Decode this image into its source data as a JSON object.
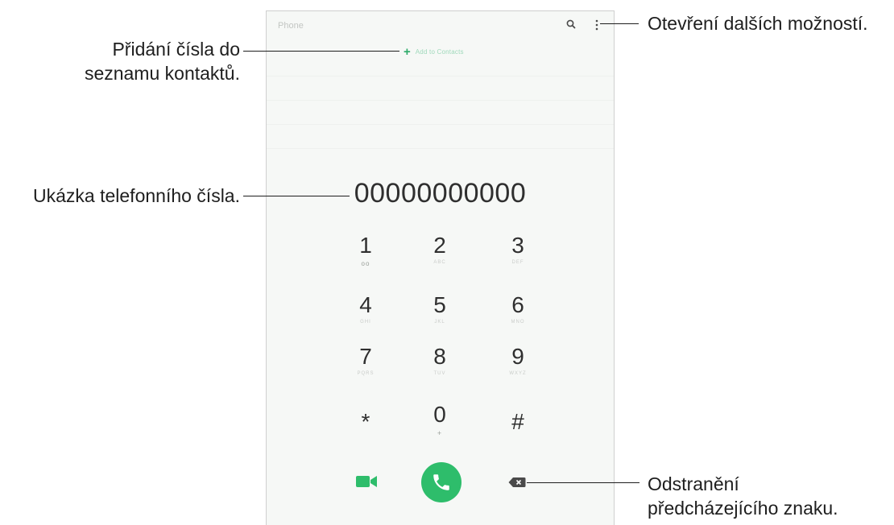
{
  "phone": {
    "app_title": "Phone",
    "add_to_contacts": "Add to Contacts",
    "number": "00000000000",
    "keys": [
      {
        "digit": "1",
        "sub": "oo"
      },
      {
        "digit": "2",
        "sub": "ABC"
      },
      {
        "digit": "3",
        "sub": "DEF"
      },
      {
        "digit": "4",
        "sub": "GHI"
      },
      {
        "digit": "5",
        "sub": "JKL"
      },
      {
        "digit": "6",
        "sub": "MNO"
      },
      {
        "digit": "7",
        "sub": "PQRS"
      },
      {
        "digit": "8",
        "sub": "TUV"
      },
      {
        "digit": "9",
        "sub": "WXYZ"
      },
      {
        "digit": "*",
        "sub": ""
      },
      {
        "digit": "0",
        "sub": "+"
      },
      {
        "digit": "#",
        "sub": ""
      }
    ],
    "accent_color": "#2ebd6b"
  },
  "callouts": {
    "add_number": [
      "Přidání čísla do",
      "seznamu kontaktů."
    ],
    "number_preview": "Ukázka telefonního čísla.",
    "more_options": "Otevření dalších možností.",
    "delete_char": [
      "Odstranění",
      "předcházejícího znaku."
    ]
  }
}
